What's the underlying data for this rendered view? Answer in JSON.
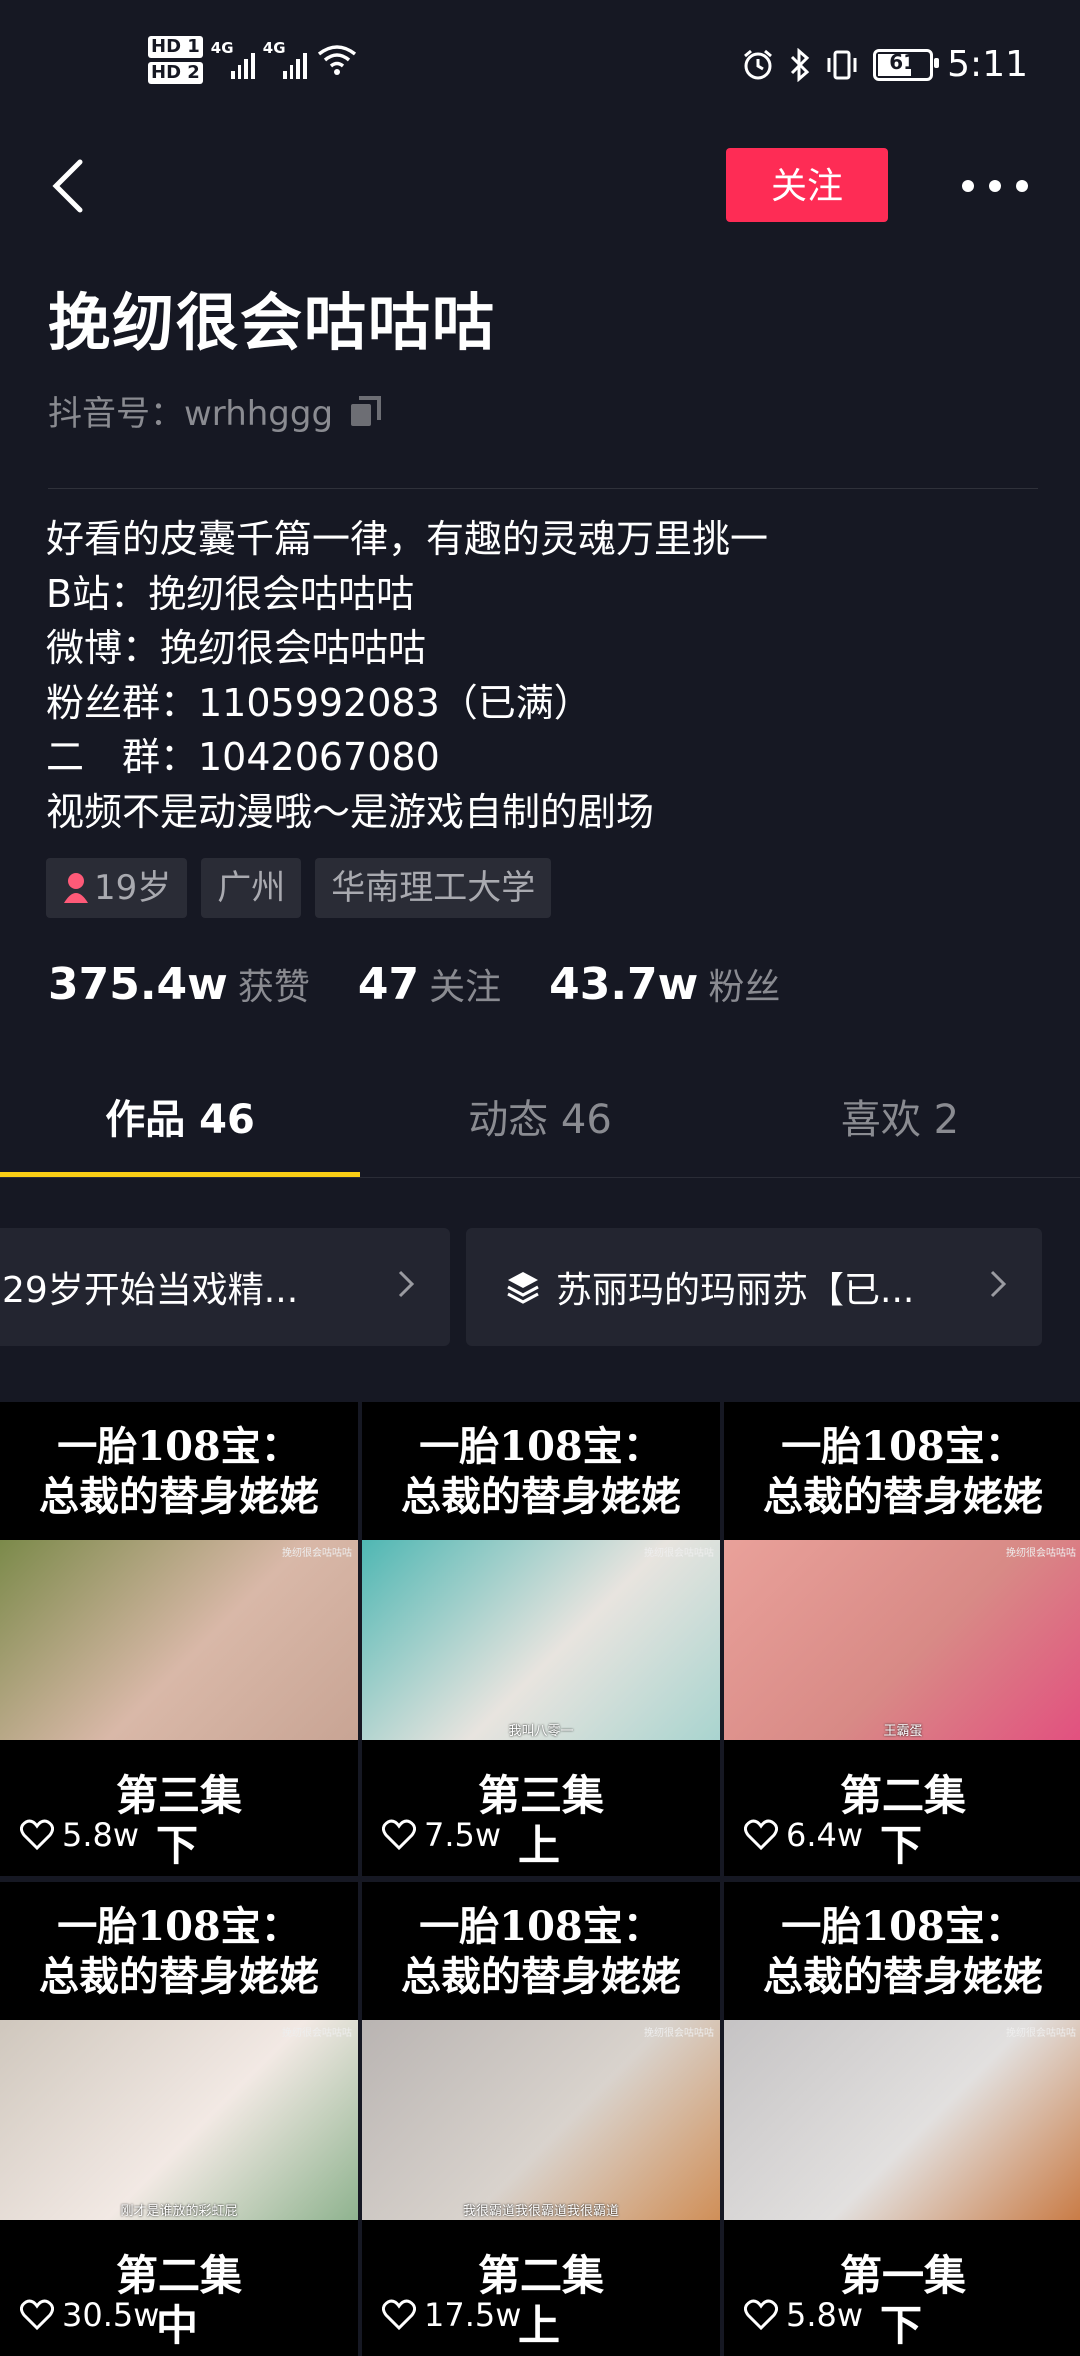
{
  "status_bar": {
    "hd1": "HD 1",
    "hd2": "HD 2",
    "net1": "4G",
    "net2": "4G",
    "battery": "61",
    "time": "5:11"
  },
  "header": {
    "follow_label": "关注"
  },
  "profile": {
    "nickname": "挽纫很会咕咕咕",
    "douyin_id": "抖音号：wrhhggg",
    "bio_lines": [
      "好看的皮囊千篇一律，有趣的灵魂万里挑一",
      "B站：挽纫很会咕咕咕",
      "微博：挽纫很会咕咕咕",
      "粉丝群：1105992083（已满）",
      "二　群：1042067080",
      "视频不是动漫哦～是游戏自制的剧场"
    ],
    "tags": [
      "19岁",
      "广州",
      "华南理工大学"
    ],
    "stats": [
      {
        "num": "375.4w",
        "label": "获赞"
      },
      {
        "num": "47",
        "label": "关注"
      },
      {
        "num": "43.7w",
        "label": "粉丝"
      }
    ]
  },
  "tabs": [
    {
      "label": "作品 46",
      "active": true
    },
    {
      "label": "动态 46",
      "active": false
    },
    {
      "label": "喜欢 2",
      "active": false
    }
  ],
  "collections": [
    {
      "title": "29岁开始当戏精..."
    },
    {
      "title": "苏丽玛的玛丽苏【已..."
    }
  ],
  "videos": [
    {
      "caption1": "一胎108宝：",
      "caption2": "总裁的替身姥姥",
      "episode": "第三集",
      "likes": "5.8w",
      "part": "下",
      "subtitle": "",
      "watermark": "挽纫很会咕咕咕",
      "colors": [
        "#7b8a4a",
        "#d9b8a8",
        "#c8a494"
      ]
    },
    {
      "caption1": "一胎108宝：",
      "caption2": "总裁的替身姥姥",
      "episode": "第三集",
      "likes": "7.5w",
      "part": "上",
      "subtitle": "我叫八零一",
      "watermark": "挽纫很会咕咕咕",
      "colors": [
        "#4fb7b3",
        "#e8e4df",
        "#a9d4cf"
      ]
    },
    {
      "caption1": "一胎108宝：",
      "caption2": "总裁的替身姥姥",
      "episode": "第二集",
      "likes": "6.4w",
      "part": "下",
      "subtitle": "王霸蛋",
      "watermark": "挽纫很会咕咕咕",
      "colors": [
        "#e9a19a",
        "#d88a86",
        "#e2507f"
      ]
    },
    {
      "caption1": "一胎108宝：",
      "caption2": "总裁的替身姥姥",
      "episode": "第二集",
      "likes": "30.5w",
      "part": "中",
      "subtitle": "刚才是谁放的彩虹屁",
      "watermark": "挽纫很会咕咕咕",
      "colors": [
        "#cfc7bd",
        "#f2e9e4",
        "#8fb38f"
      ]
    },
    {
      "caption1": "一胎108宝：",
      "caption2": "总裁的替身姥姥",
      "episode": "第二集",
      "likes": "17.5w",
      "part": "上",
      "subtitle": "我很霸道我很霸道我很霸道",
      "watermark": "挽纫很会咕咕咕",
      "colors": [
        "#b9b4b2",
        "#d9d3cd",
        "#d08f58"
      ]
    },
    {
      "caption1": "一胎108宝：",
      "caption2": "总裁的替身姥姥",
      "episode": "第一集",
      "likes": "5.8w",
      "part": "下",
      "subtitle": "",
      "watermark": "挽纫很会咕咕咕",
      "colors": [
        "#c5c3c4",
        "#e2e0df",
        "#c97b45"
      ]
    }
  ]
}
